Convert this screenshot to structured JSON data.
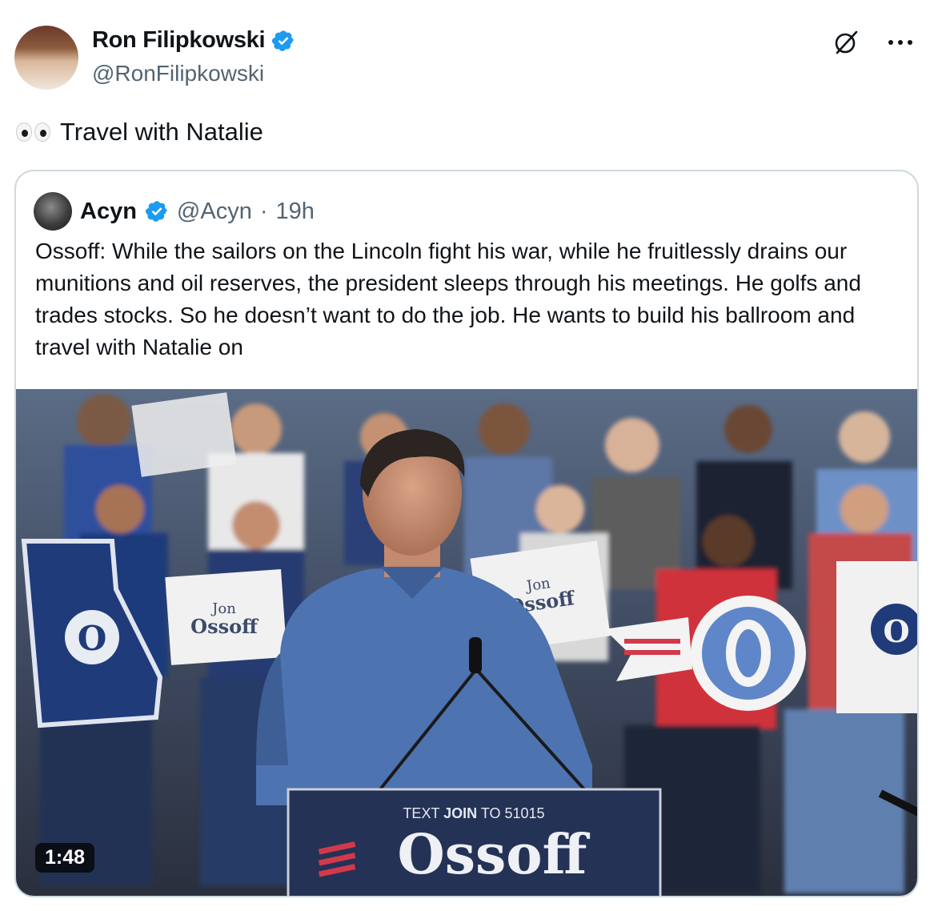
{
  "author": {
    "name": "Ron Filipkowski",
    "handle": "@RonFilipkowski",
    "verified_color": "#1d9bf0"
  },
  "icons": {
    "grok": "slashed-circle-icon",
    "more": "ellipsis-icon"
  },
  "tweet": {
    "emoji": "eyes-emoji-icon",
    "text": "Travel with Natalie"
  },
  "quoted": {
    "name": "Acyn",
    "handle": "@Acyn",
    "separator": "·",
    "time": "19h",
    "text": "Ossoff: While the sailors on the Lincoln fight his war, while he fruitlessly drains our munitions and oil reserves, the president sleeps through his meetings. He golfs and trades stocks. So he doesn’t want to do the job. He wants to build his ballroom and travel with Natalie on",
    "video": {
      "duration": "1:48",
      "podium_text_prefix": "TEXT ",
      "podium_text_bold": "JOIN",
      "podium_text_suffix": " TO 51015",
      "podium_brand": "Ossoff",
      "sign_text_jon": "Jon",
      "sign_text_ossoff": "Ossoff",
      "logo_letter": "O"
    }
  }
}
